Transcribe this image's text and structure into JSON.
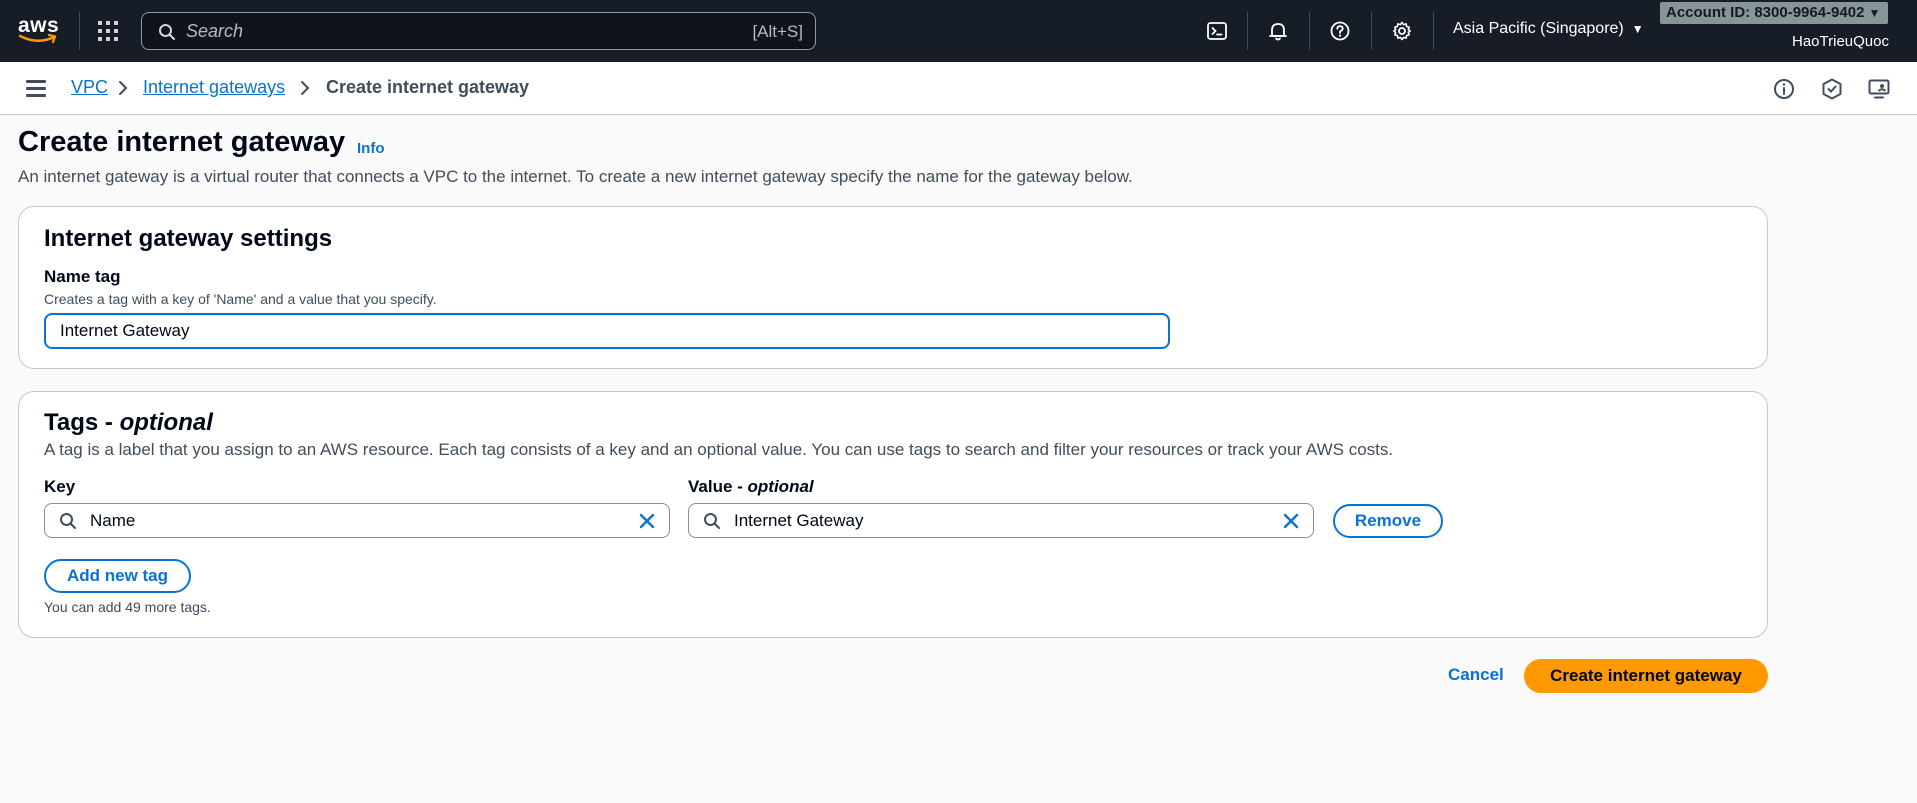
{
  "topnav": {
    "logo": "aws",
    "search_placeholder": "Search",
    "search_shortcut": "[Alt+S]",
    "icons": [
      "cloudshell-icon",
      "bell-icon",
      "help-icon",
      "gear-icon"
    ],
    "region": "Asia Pacific (Singapore)",
    "account": "Account ID: 8300-9964-9402",
    "username": "HaoTrieuQuoc"
  },
  "breadcrumb": {
    "items": [
      "VPC",
      "Internet gateways"
    ],
    "current": "Create internet gateway"
  },
  "header": {
    "title": "Create internet gateway",
    "info": "Info",
    "description": "An internet gateway is a virtual router that connects a VPC to the internet. To create a new internet gateway specify the name for the gateway below."
  },
  "settings": {
    "title": "Internet gateway settings",
    "name_label": "Name tag",
    "name_hint": "Creates a tag with a key of 'Name' and a value that you specify.",
    "name_value": "Internet Gateway"
  },
  "tags": {
    "title_main": "Tags - ",
    "title_optional": "optional",
    "description": "A tag is a label that you assign to an AWS resource. Each tag consists of a key and an optional value. You can use tags to search and filter your resources or track your AWS costs.",
    "key_label": "Key",
    "value_label_main": "Value - ",
    "value_label_optional": "optional",
    "rows": [
      {
        "key": "Name",
        "value": "Internet Gateway"
      }
    ],
    "remove_label": "Remove",
    "add_label": "Add new tag",
    "remaining": "You can add 49 more tags."
  },
  "footer": {
    "cancel": "Cancel",
    "submit": "Create internet gateway"
  },
  "colors": {
    "nav_bg": "#161d26",
    "link": "#0972d3",
    "primary": "#ff9900"
  }
}
